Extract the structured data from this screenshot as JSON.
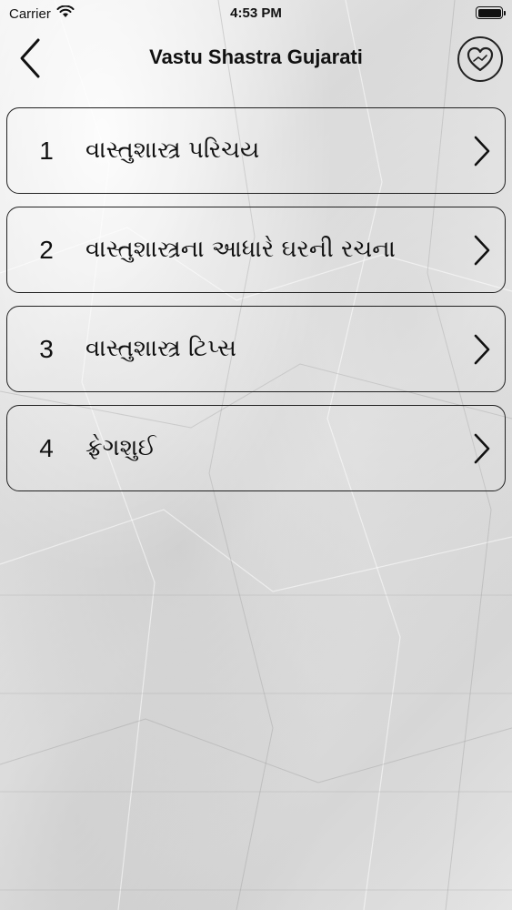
{
  "status_bar": {
    "carrier": "Carrier",
    "time": "4:53 PM",
    "wifi_icon": "wifi-icon",
    "battery_icon": "battery-icon"
  },
  "nav": {
    "title": "Vastu Shastra Gujarati",
    "back_icon": "chevron-left-icon",
    "favorite_icon": "heart-icon"
  },
  "items": [
    {
      "number": "1",
      "title": "વાસ્તુશાસ્ત્ર પરિચય"
    },
    {
      "number": "2",
      "title": "વાસ્તુશાસ્ત્રના આધારે ઘરની રચના"
    },
    {
      "number": "3",
      "title": "વાસ્તુશાસ્ત્ર ટિપ્સ"
    },
    {
      "number": "4",
      "title": "ફ્રેગશુઈ"
    }
  ],
  "colors": {
    "text": "#111111",
    "border": "#222222"
  }
}
